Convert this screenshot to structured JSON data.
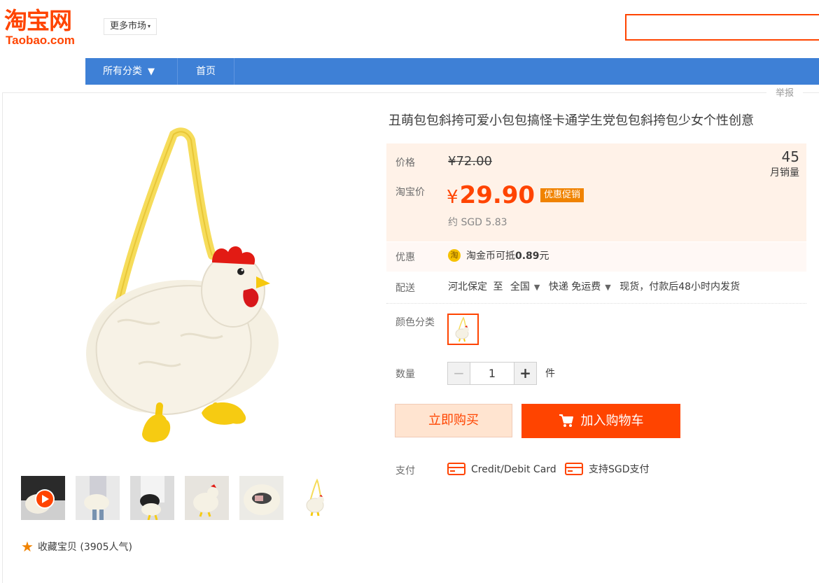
{
  "header": {
    "logo_cn": "淘宝网",
    "logo_en": "Taobao.com",
    "market_label": "更多市场",
    "search_placeholder": ""
  },
  "nav": {
    "all_categories": "所有分类",
    "home": "首页"
  },
  "report_link": "举报",
  "product": {
    "title": "丑萌包包斜挎可爱小包包搞怪卡通学生党包包斜挎包少女个性创意",
    "price_label": "价格",
    "original_price": "¥72.00",
    "taobao_price_label": "淘宝价",
    "price_symbol": "¥",
    "price": "29.90",
    "promo_tag": "优惠促销",
    "sgd_price": "约 SGD 5.83",
    "monthly_sales_count": "45",
    "monthly_sales_label": "月销量",
    "discount_label": "优惠",
    "coin_icon_char": "淘",
    "coin_text_prefix": "淘金币可抵",
    "coin_amount": "0.89",
    "coin_text_suffix": "元",
    "shipping_label": "配送",
    "ship_from": "河北保定",
    "ship_to_word": "至",
    "ship_region": "全国",
    "ship_method": "快递 免运费",
    "ship_note": "现货，付款后48小时内发货",
    "color_label": "颜色分类",
    "quantity_label": "数量",
    "quantity_minus": "−",
    "quantity_value": "1",
    "quantity_plus": "+",
    "quantity_unit": "件",
    "buy_now": "立即购买",
    "add_to_cart": "加入购物车",
    "payment_label": "支付",
    "pay_option_1": "Credit/Debit Card",
    "pay_option_2": "支持SGD支付",
    "favorite_text": "收藏宝贝 (3905人气)"
  },
  "colors": {
    "brand_orange": "#ff4400",
    "nav_blue": "#3e80d6",
    "promo_orange": "#f08300",
    "price_bg": "#fff2e8"
  },
  "icons": [
    "chicken-bag-image",
    "play-icon",
    "star-icon",
    "coin-icon",
    "cart-icon",
    "card-icon",
    "dropdown-arrow-icon"
  ]
}
